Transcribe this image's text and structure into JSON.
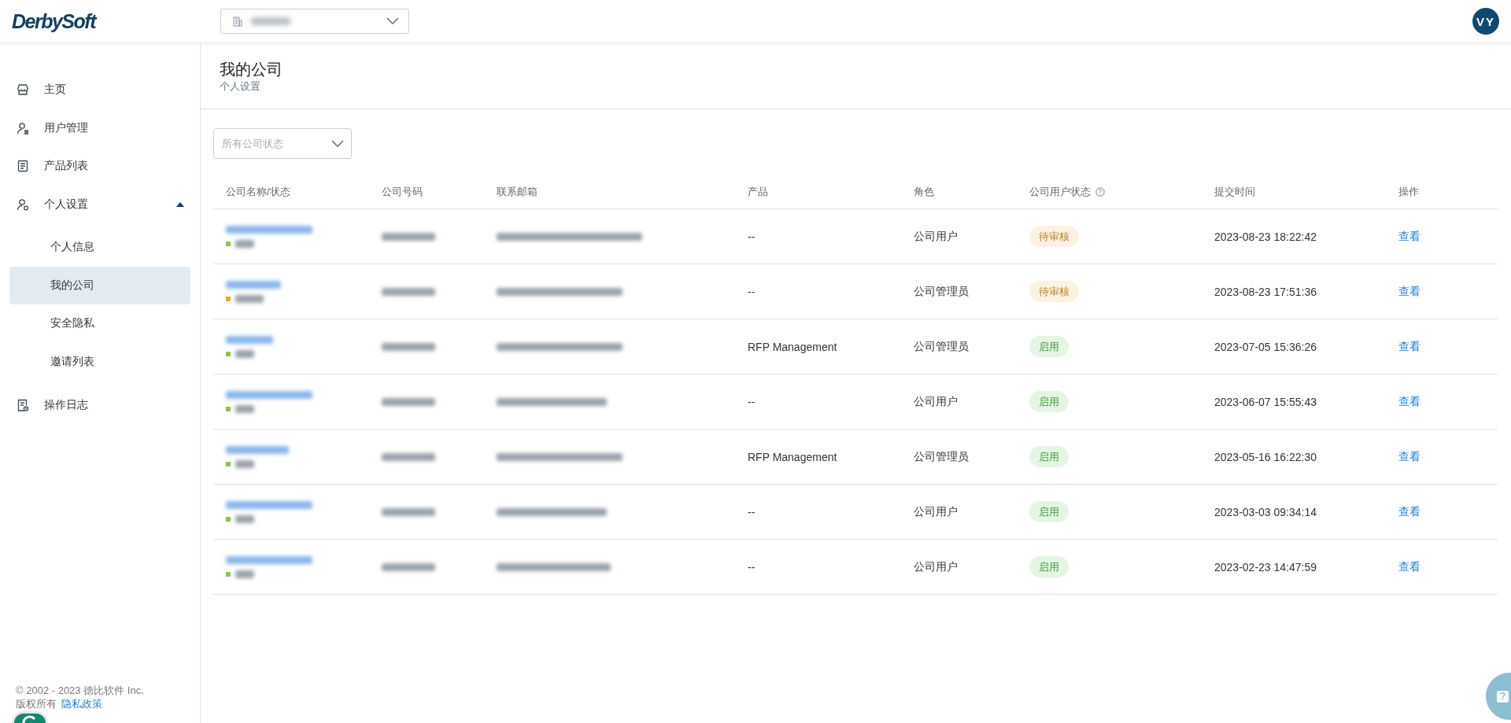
{
  "topbar": {
    "logo": "DerbySoft",
    "avatar": "VY"
  },
  "sidebar": {
    "items": [
      {
        "label": "主页",
        "selected": false
      },
      {
        "label": "用户管理",
        "selected": false
      },
      {
        "label": "产品列表",
        "selected": false
      },
      {
        "label": "个人设置",
        "selected": false,
        "expanded": true,
        "children": [
          {
            "label": "个人信息",
            "selected": false
          },
          {
            "label": "我的公司",
            "selected": true
          },
          {
            "label": "安全隐私",
            "selected": false
          },
          {
            "label": "邀请列表",
            "selected": false
          }
        ]
      },
      {
        "label": "操作日志",
        "selected": false
      }
    ],
    "footer": {
      "copyright": "© 2002 - 2023 德比软件 Inc.",
      "rights": "版权所有",
      "privacy_link": "隐私政策"
    }
  },
  "page_header": {
    "title": "我的公司",
    "breadcrumb": "个人设置"
  },
  "filter": {
    "placeholder": "所有公司状态"
  },
  "table": {
    "columns": [
      {
        "label": "公司名称/状态"
      },
      {
        "label": "公司号码"
      },
      {
        "label": "联系邮箱"
      },
      {
        "label": "产品"
      },
      {
        "label": "角色"
      },
      {
        "label": "公司用户状态",
        "help": true
      },
      {
        "label": "提交时间"
      },
      {
        "label": "操作"
      }
    ],
    "rows": [
      {
        "color": "#8bc34a",
        "product": "--",
        "role": "公司用户",
        "user_status": {
          "label": "待审核",
          "kind": "pending"
        },
        "submitted": "2023-08-23 18:22:42",
        "action": "查看"
      },
      {
        "color": "#f5a623",
        "product": "--",
        "role": "公司管理员",
        "user_status": {
          "label": "待审核",
          "kind": "pending"
        },
        "submitted": "2023-08-23 17:51:36",
        "action": "查看"
      },
      {
        "color": "#8bc34a",
        "product": "RFP Management",
        "role": "公司管理员",
        "user_status": {
          "label": "启用",
          "kind": "enabled"
        },
        "submitted": "2023-07-05 15:36:26",
        "action": "查看"
      },
      {
        "color": "#8bc34a",
        "product": "--",
        "role": "公司用户",
        "user_status": {
          "label": "启用",
          "kind": "enabled"
        },
        "submitted": "2023-06-07 15:55:43",
        "action": "查看"
      },
      {
        "color": "#8bc34a",
        "product": "RFP Management",
        "role": "公司管理员",
        "user_status": {
          "label": "启用",
          "kind": "enabled"
        },
        "submitted": "2023-05-16 16:22:30",
        "action": "查看"
      },
      {
        "color": "#8bc34a",
        "product": "--",
        "role": "公司用户",
        "user_status": {
          "label": "启用",
          "kind": "enabled"
        },
        "submitted": "2023-03-03 09:34:14",
        "action": "查看"
      },
      {
        "color": "#8bc34a",
        "product": "--",
        "role": "公司用户",
        "user_status": {
          "label": "启用",
          "kind": "enabled"
        },
        "submitted": "2023-02-23 14:47:59",
        "action": "查看"
      }
    ]
  },
  "help_widget": {
    "glyph": "?"
  }
}
